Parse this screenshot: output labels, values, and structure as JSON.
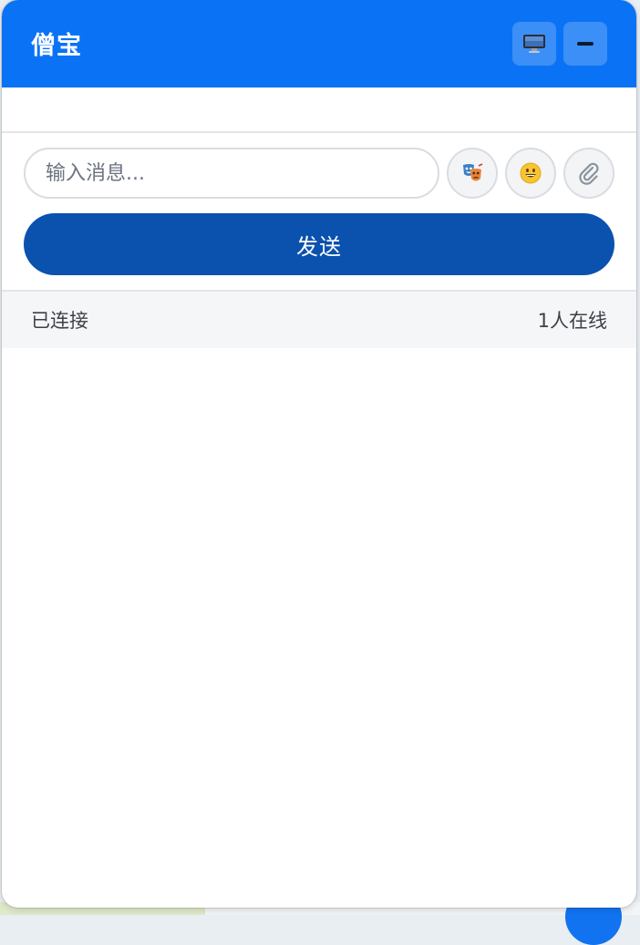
{
  "header": {
    "title": "僧宝",
    "screen_icon": "monitor-icon",
    "minimize_icon": "minimize-icon"
  },
  "composer": {
    "placeholder": "输入消息...",
    "value": "",
    "mask_icon": "performing-arts-icon",
    "emoji_icon": "smiley-icon",
    "attach_icon": "paperclip-icon",
    "send_label": "发送"
  },
  "status": {
    "connection": "已连接",
    "online": "1人在线"
  },
  "colors": {
    "header_bg": "#0a73f5",
    "send_bg": "#0a52ad",
    "status_bg": "#f5f6f8"
  }
}
